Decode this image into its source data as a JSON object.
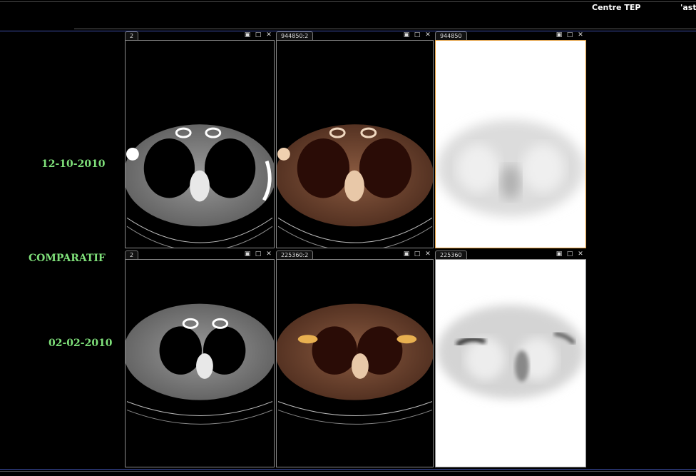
{
  "header": {
    "brand_left": "Centre TEP",
    "brand_right": "'ast"
  },
  "labels": {
    "date_top": "12-10-2010",
    "comparatif": "COMPARATIF",
    "date_bottom": "02-02-2010"
  },
  "viewports": [
    {
      "id": "ct-top",
      "tab": "2",
      "modality": "CT",
      "active": false
    },
    {
      "id": "fusion-top",
      "tab": "944850:2",
      "modality": "PET/CT fusion",
      "active": false
    },
    {
      "id": "pet-top",
      "tab": "944850",
      "modality": "PET",
      "active": true
    },
    {
      "id": "ct-bottom",
      "tab": "2",
      "modality": "CT",
      "active": false
    },
    {
      "id": "fusion-bottom",
      "tab": "225360:2",
      "modality": "PET/CT fusion",
      "active": false
    },
    {
      "id": "pet-bottom",
      "tab": "225360",
      "modality": "PET",
      "active": false
    }
  ],
  "controls": {
    "settings_icon": "▣",
    "maximize_icon": "□",
    "close_icon": "✕"
  },
  "colors": {
    "label_green": "#7fe07a",
    "active_border": "#e29a35",
    "accent_blue": "#3d4fa8"
  }
}
